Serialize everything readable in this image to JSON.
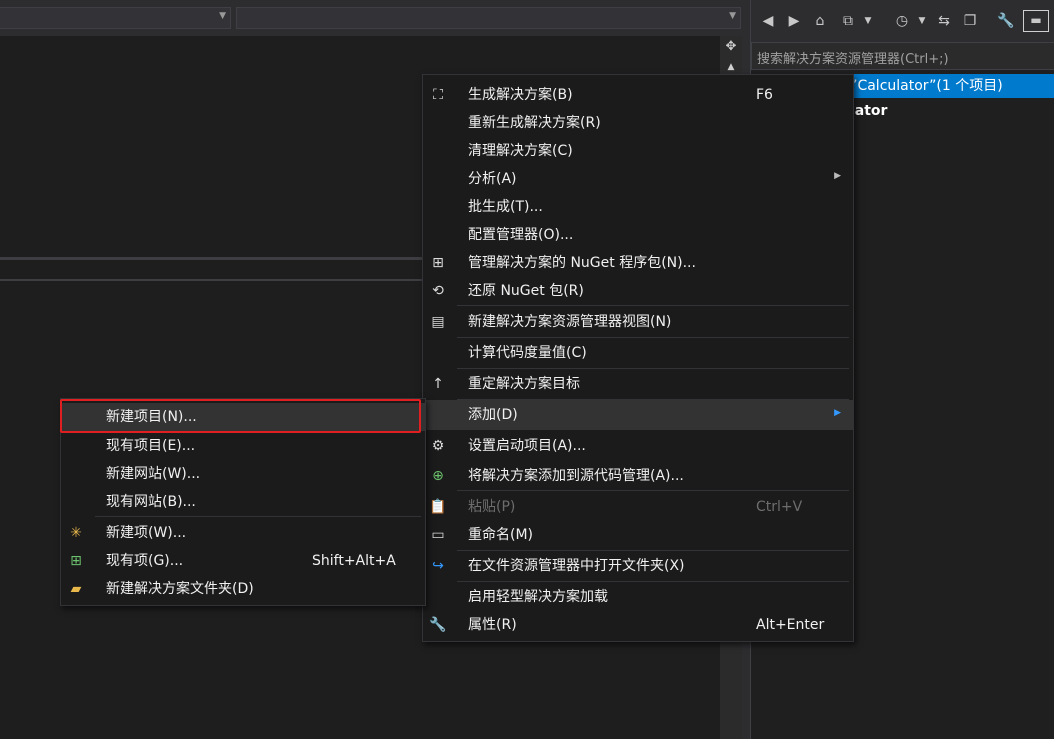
{
  "solution_explorer": {
    "search_placeholder": "搜索解决方案资源管理器(Ctrl+;)",
    "solution_row": "’Calculator”(1 个项目)",
    "project_row": "ulator"
  },
  "context_menu": {
    "items": [
      {
        "label": "生成解决方案(B)",
        "shortcut": "F6",
        "icon": "build-icon"
      },
      {
        "label": "重新生成解决方案(R)",
        "shortcut": ""
      },
      {
        "label": "清理解决方案(C)",
        "shortcut": ""
      },
      {
        "label": "分析(A)",
        "shortcut": "",
        "submenu": true
      },
      {
        "label": "批生成(T)...",
        "shortcut": ""
      },
      {
        "label": "配置管理器(O)...",
        "shortcut": ""
      },
      {
        "label": "管理解决方案的 NuGet 程序包(N)...",
        "shortcut": "",
        "icon": "nuget-icon"
      },
      {
        "label": "还原 NuGet 包(R)",
        "shortcut": "",
        "icon": "restore-icon"
      },
      {
        "label": "新建解决方案资源管理器视图(N)",
        "shortcut": "",
        "icon": "new-view-icon"
      },
      {
        "label": "计算代码度量值(C)",
        "shortcut": ""
      },
      {
        "label": "重定解决方案目标",
        "shortcut": "",
        "icon": "arrow-up-icon"
      },
      {
        "label": "添加(D)",
        "shortcut": "",
        "submenu": true
      },
      {
        "label": "设置启动项目(A)...",
        "shortcut": "",
        "icon": "gear-icon"
      },
      {
        "label": "将解决方案添加到源代码管理(A)...",
        "shortcut": "",
        "icon": "add-source-control-icon"
      },
      {
        "label": "粘贴(P)",
        "shortcut": "Ctrl+V",
        "icon": "paste-icon",
        "disabled": true
      },
      {
        "label": "重命名(M)",
        "shortcut": "",
        "icon": "rename-icon"
      },
      {
        "label": "在文件资源管理器中打开文件夹(X)",
        "shortcut": "",
        "icon": "open-folder-icon"
      },
      {
        "label": "启用轻型解决方案加载",
        "shortcut": ""
      },
      {
        "label": "属性(R)",
        "shortcut": "Alt+Enter",
        "icon": "wrench-icon"
      }
    ]
  },
  "add_submenu": {
    "items": [
      {
        "label": "新建项目(N)...",
        "shortcut": ""
      },
      {
        "label": "现有项目(E)...",
        "shortcut": ""
      },
      {
        "label": "新建网站(W)...",
        "shortcut": ""
      },
      {
        "label": "现有网站(B)...",
        "shortcut": ""
      },
      {
        "label": "新建项(W)...",
        "shortcut": "",
        "icon": "new-item-icon"
      },
      {
        "label": "现有项(G)...",
        "shortcut": "Shift+Alt+A",
        "icon": "existing-item-icon"
      },
      {
        "label": "新建解决方案文件夹(D)",
        "shortcut": "",
        "icon": "new-folder-icon"
      }
    ]
  },
  "colors": {
    "accent": "#007acc",
    "highlight_border": "#e02020",
    "background": "#1e1e1e"
  }
}
